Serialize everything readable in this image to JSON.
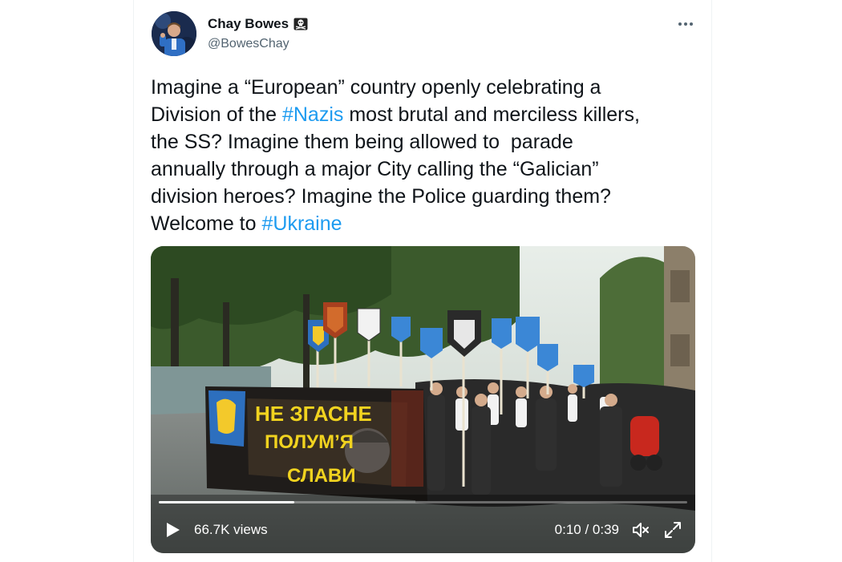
{
  "tweet": {
    "author": {
      "display_name": "Chay Bowes",
      "handle": "@BowesChay",
      "badge_icon": "skull-crossbones-icon"
    },
    "text_parts": [
      "Imagine a “European” country openly celebrating a\nDivision of the ",
      "#Nazis",
      " most brutal and merciless killers,\nthe SS? Imagine them being allowed to  parade\nannually through a major City calling the “Galician”\ndivision heroes? Imagine the Police guarding them?\nWelcome to ",
      "#Ukraine"
    ],
    "media": {
      "banner_text": [
        "НЕ ЗГАСНЕ",
        "ПОЛУМ’Я",
        "СЛАВИ"
      ],
      "views": "66.7K views",
      "time": "0:10 / 0:39",
      "progress": 0.256
    }
  },
  "colors": {
    "accent": "#1d9bf0",
    "text": "#0f1419",
    "secondary": "#536471"
  }
}
